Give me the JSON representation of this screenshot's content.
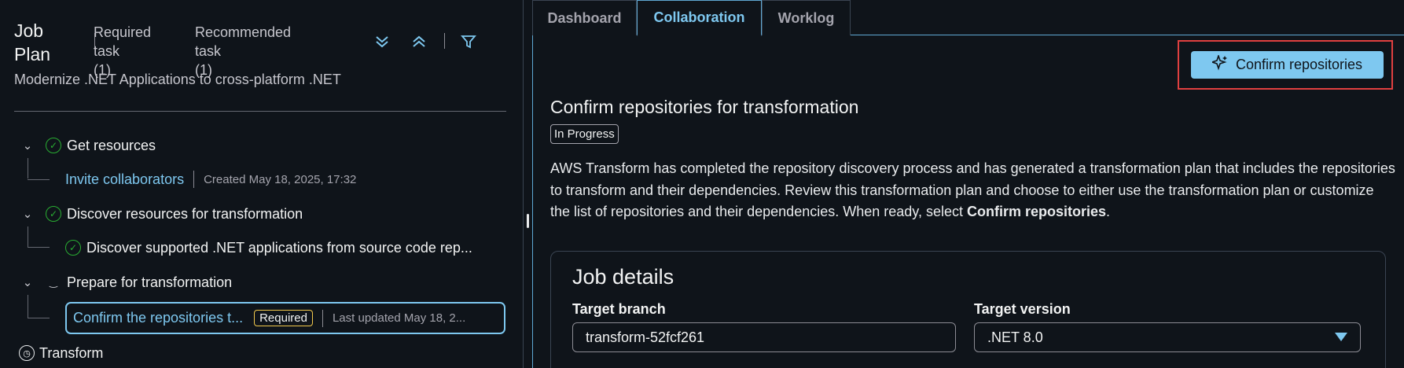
{
  "left": {
    "title": "Job Plan",
    "required_task": "Required task",
    "required_count": "(1)",
    "recommended_task": "Recommended task",
    "recommended_count": "(1)",
    "subtitle": "Modernize .NET Applications to cross-platform .NET",
    "tree": {
      "get_resources": "Get resources",
      "invite_collaborators": "Invite collaborators",
      "invite_meta": "Created May 18, 2025, 17:32",
      "discover_resources": "Discover resources for transformation",
      "discover_supported": "Discover supported .NET applications from source code rep...",
      "prepare": "Prepare for transformation",
      "confirm_task": "Confirm the repositories t...",
      "required_badge": "Required",
      "confirm_meta": "Last updated May 18, 2...",
      "transform": "Transform"
    }
  },
  "tabs": [
    "Dashboard",
    "Collaboration",
    "Worklog"
  ],
  "main": {
    "confirm_button": "Confirm repositories",
    "heading": "Confirm repositories for transformation",
    "status": "In Progress",
    "paragraph_1": "AWS Transform has completed the repository discovery process and has generated a transformation plan that includes the repositories to transform and their dependencies. Review this transformation plan and choose to either use the transformation plan or customize the list of repositories and their dependencies. When ready, select ",
    "paragraph_bold": "Confirm repositories",
    "paragraph_end": ".",
    "card": {
      "title": "Job details",
      "target_branch_label": "Target branch",
      "target_branch_value": "transform-52fcf261",
      "target_version_label": "Target version",
      "target_version_value": ".NET 8.0"
    }
  },
  "colors": {
    "accent": "#7ec8f0",
    "success": "#29ad32",
    "highlight_border": "#e04040",
    "badge_border": "#f2c94c",
    "background": "#0f141a"
  },
  "icons": [
    "expand-all-icon",
    "collapse-all-icon",
    "filter-icon",
    "check-circle-icon",
    "chevron-down-icon",
    "clock-icon",
    "sparkle-icon",
    "caret-down-icon"
  ]
}
